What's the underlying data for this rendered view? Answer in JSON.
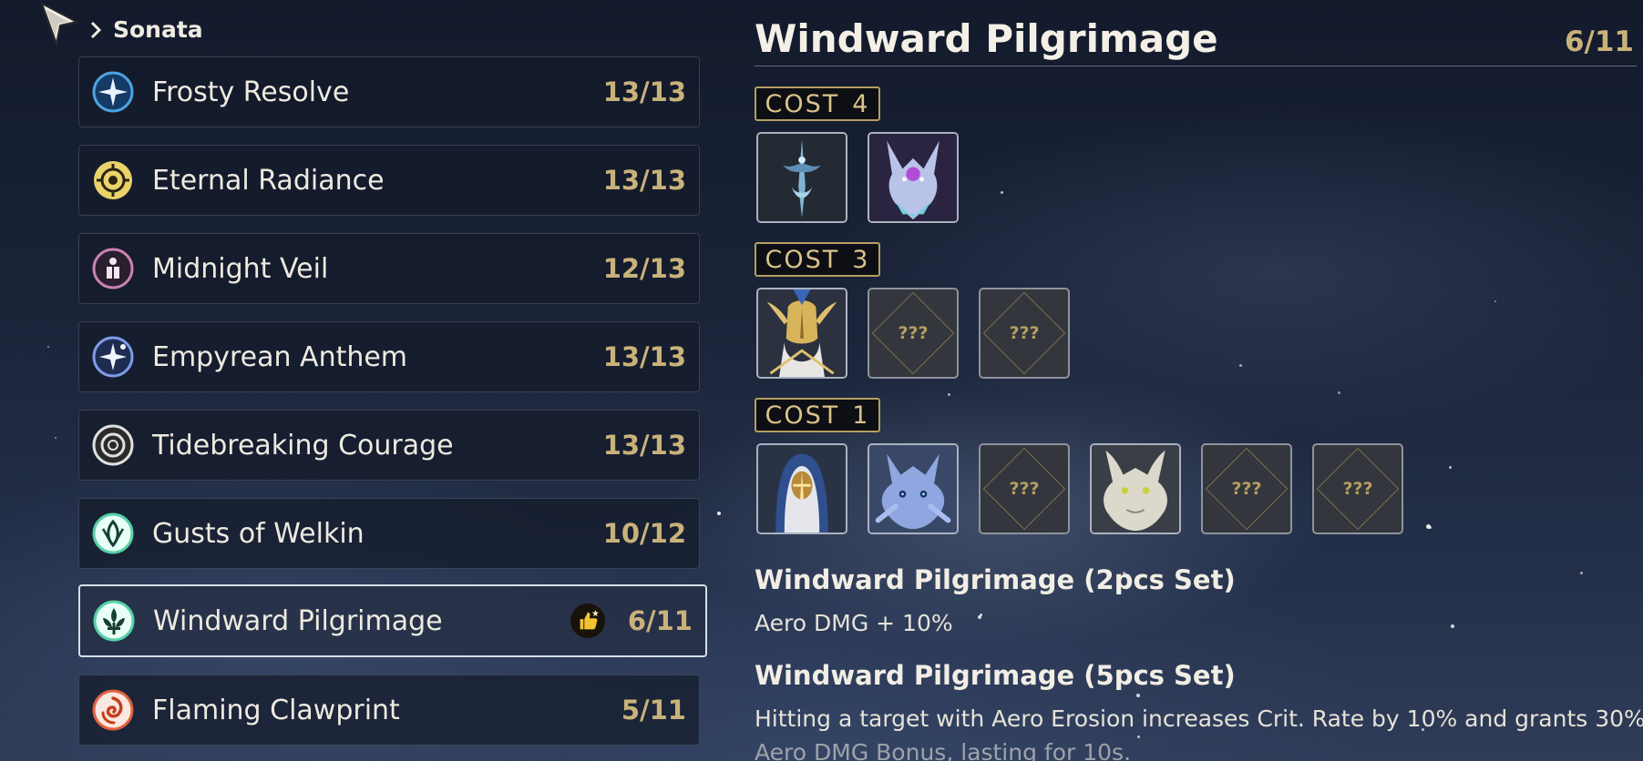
{
  "breadcrumb": {
    "label": "Sonata"
  },
  "sets": [
    {
      "name": "Frosty Resolve",
      "count": "13/13",
      "icon": "frost-star-icon",
      "color": "#4da3e0"
    },
    {
      "name": "Eternal Radiance",
      "count": "13/13",
      "icon": "radiance-sun-icon",
      "color": "#e9d36a"
    },
    {
      "name": "Midnight Veil",
      "count": "12/13",
      "icon": "veil-figure-icon",
      "color": "#c982b2"
    },
    {
      "name": "Empyrean Anthem",
      "count": "13/13",
      "icon": "anthem-spark-icon",
      "color": "#7f9be6"
    },
    {
      "name": "Tidebreaking Courage",
      "count": "13/13",
      "icon": "tide-ring-icon",
      "color": "#d9d9d9"
    },
    {
      "name": "Gusts of Welkin",
      "count": "10/12",
      "icon": "welkin-wind-icon",
      "color": "#57d1a8"
    },
    {
      "name": "Windward Pilgrimage",
      "count": "6/11",
      "icon": "pilgrim-fleur-icon",
      "color": "#57d1a8",
      "selected": true,
      "recommended_icon": "thumbs-up-icon"
    },
    {
      "name": "Flaming Clawprint",
      "count": "5/11",
      "icon": "flame-swirl-icon",
      "color": "#e0613f"
    }
  ],
  "detail": {
    "title": "Windward Pilgrimage",
    "count": "6/11",
    "cost_groups": [
      {
        "label": "COST",
        "value": "4",
        "slots": [
          {
            "type": "echo",
            "name": "spectral-sword-echo-icon"
          },
          {
            "type": "echo",
            "name": "crystal-dragon-echo-icon"
          }
        ]
      },
      {
        "label": "COST",
        "value": "3",
        "slots": [
          {
            "type": "echo",
            "name": "golden-knight-echo-icon"
          },
          {
            "type": "unknown",
            "text": "???"
          },
          {
            "type": "unknown",
            "text": "???"
          }
        ]
      },
      {
        "label": "COST",
        "value": "1",
        "slots": [
          {
            "type": "echo",
            "name": "hooded-pilgrim-echo-icon"
          },
          {
            "type": "echo",
            "name": "blue-drake-echo-icon"
          },
          {
            "type": "unknown",
            "text": "???"
          },
          {
            "type": "echo",
            "name": "white-drake-echo-icon"
          },
          {
            "type": "unknown",
            "text": "???"
          },
          {
            "type": "unknown",
            "text": "???"
          }
        ]
      }
    ],
    "effects": [
      {
        "title": "Windward Pilgrimage (2pcs Set)",
        "desc": "Aero DMG + 10%"
      },
      {
        "title": "Windward Pilgrimage (5pcs Set)",
        "desc": "Hitting a target with Aero Erosion increases Crit. Rate by 10% and grants 30%",
        "desc_cut": "Aero DMG Bonus, lasting for 10s."
      }
    ]
  }
}
